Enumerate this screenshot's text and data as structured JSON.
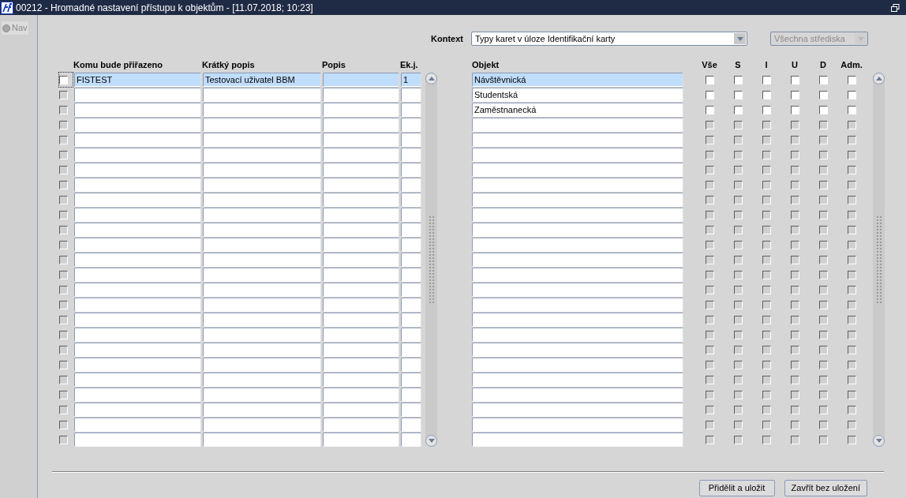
{
  "window": {
    "title": "00212 - Hromadné nastavení přístupu k objektům - [11.07.2018; 10:23]"
  },
  "sidebar": {
    "items": [
      {
        "label": "Nav",
        "selected": false
      }
    ]
  },
  "kontext": {
    "label": "Kontext",
    "value": "Typy karet v úloze Identifikační karty",
    "disabled": false
  },
  "strediska": {
    "value": "Všechna střediska",
    "disabled": true
  },
  "left_table": {
    "columns": [
      "Komu bude přiřazeno",
      "Krátký popis",
      "Popis",
      "Ek.j."
    ],
    "rows": [
      {
        "selected": true,
        "disabled": false,
        "checked": false,
        "cells": [
          "FISTEST",
          "Testovací uživatel BBM",
          "",
          "1"
        ]
      },
      {
        "selected": false,
        "disabled": true,
        "checked": false,
        "cells": []
      },
      {
        "selected": false,
        "disabled": true,
        "checked": false,
        "cells": []
      },
      {
        "selected": false,
        "disabled": true,
        "checked": false,
        "cells": []
      },
      {
        "selected": false,
        "disabled": true,
        "checked": false,
        "cells": []
      },
      {
        "selected": false,
        "disabled": true,
        "checked": false,
        "cells": []
      },
      {
        "selected": false,
        "disabled": true,
        "checked": false,
        "cells": []
      },
      {
        "selected": false,
        "disabled": true,
        "checked": false,
        "cells": []
      },
      {
        "selected": false,
        "disabled": true,
        "checked": false,
        "cells": []
      },
      {
        "selected": false,
        "disabled": true,
        "checked": false,
        "cells": []
      },
      {
        "selected": false,
        "disabled": true,
        "checked": false,
        "cells": []
      },
      {
        "selected": false,
        "disabled": true,
        "checked": false,
        "cells": []
      },
      {
        "selected": false,
        "disabled": true,
        "checked": false,
        "cells": []
      },
      {
        "selected": false,
        "disabled": true,
        "checked": false,
        "cells": []
      },
      {
        "selected": false,
        "disabled": true,
        "checked": false,
        "cells": []
      },
      {
        "selected": false,
        "disabled": true,
        "checked": false,
        "cells": []
      },
      {
        "selected": false,
        "disabled": true,
        "checked": false,
        "cells": []
      },
      {
        "selected": false,
        "disabled": true,
        "checked": false,
        "cells": []
      },
      {
        "selected": false,
        "disabled": true,
        "checked": false,
        "cells": []
      },
      {
        "selected": false,
        "disabled": true,
        "checked": false,
        "cells": []
      },
      {
        "selected": false,
        "disabled": true,
        "checked": false,
        "cells": []
      },
      {
        "selected": false,
        "disabled": true,
        "checked": false,
        "cells": []
      },
      {
        "selected": false,
        "disabled": true,
        "checked": false,
        "cells": []
      },
      {
        "selected": false,
        "disabled": true,
        "checked": false,
        "cells": []
      },
      {
        "selected": false,
        "disabled": true,
        "checked": false,
        "cells": []
      }
    ]
  },
  "right_table": {
    "columns": [
      "Objekt",
      "Vše",
      "S",
      "I",
      "U",
      "D",
      "Adm."
    ],
    "rows": [
      {
        "objekt": "Návštěvnická",
        "selected": true,
        "disabled": false,
        "checked": [
          false,
          false,
          false,
          false,
          false,
          false
        ]
      },
      {
        "objekt": "Studentská",
        "selected": false,
        "disabled": false,
        "checked": [
          false,
          false,
          false,
          false,
          false,
          false
        ]
      },
      {
        "objekt": "Zaměstnanecká",
        "selected": false,
        "disabled": false,
        "checked": [
          false,
          false,
          false,
          false,
          false,
          false
        ]
      },
      {
        "selected": false,
        "disabled": true,
        "checked": [
          false,
          false,
          false,
          false,
          false,
          false
        ]
      },
      {
        "selected": false,
        "disabled": true,
        "checked": [
          false,
          false,
          false,
          false,
          false,
          false
        ]
      },
      {
        "selected": false,
        "disabled": true,
        "checked": [
          false,
          false,
          false,
          false,
          false,
          false
        ]
      },
      {
        "selected": false,
        "disabled": true,
        "checked": [
          false,
          false,
          false,
          false,
          false,
          false
        ]
      },
      {
        "selected": false,
        "disabled": true,
        "checked": [
          false,
          false,
          false,
          false,
          false,
          false
        ]
      },
      {
        "selected": false,
        "disabled": true,
        "checked": [
          false,
          false,
          false,
          false,
          false,
          false
        ]
      },
      {
        "selected": false,
        "disabled": true,
        "checked": [
          false,
          false,
          false,
          false,
          false,
          false
        ]
      },
      {
        "selected": false,
        "disabled": true,
        "checked": [
          false,
          false,
          false,
          false,
          false,
          false
        ]
      },
      {
        "selected": false,
        "disabled": true,
        "checked": [
          false,
          false,
          false,
          false,
          false,
          false
        ]
      },
      {
        "selected": false,
        "disabled": true,
        "checked": [
          false,
          false,
          false,
          false,
          false,
          false
        ]
      },
      {
        "selected": false,
        "disabled": true,
        "checked": [
          false,
          false,
          false,
          false,
          false,
          false
        ]
      },
      {
        "selected": false,
        "disabled": true,
        "checked": [
          false,
          false,
          false,
          false,
          false,
          false
        ]
      },
      {
        "selected": false,
        "disabled": true,
        "checked": [
          false,
          false,
          false,
          false,
          false,
          false
        ]
      },
      {
        "selected": false,
        "disabled": true,
        "checked": [
          false,
          false,
          false,
          false,
          false,
          false
        ]
      },
      {
        "selected": false,
        "disabled": true,
        "checked": [
          false,
          false,
          false,
          false,
          false,
          false
        ]
      },
      {
        "selected": false,
        "disabled": true,
        "checked": [
          false,
          false,
          false,
          false,
          false,
          false
        ]
      },
      {
        "selected": false,
        "disabled": true,
        "checked": [
          false,
          false,
          false,
          false,
          false,
          false
        ]
      },
      {
        "selected": false,
        "disabled": true,
        "checked": [
          false,
          false,
          false,
          false,
          false,
          false
        ]
      },
      {
        "selected": false,
        "disabled": true,
        "checked": [
          false,
          false,
          false,
          false,
          false,
          false
        ]
      },
      {
        "selected": false,
        "disabled": true,
        "checked": [
          false,
          false,
          false,
          false,
          false,
          false
        ]
      },
      {
        "selected": false,
        "disabled": true,
        "checked": [
          false,
          false,
          false,
          false,
          false,
          false
        ]
      },
      {
        "selected": false,
        "disabled": true,
        "checked": [
          false,
          false,
          false,
          false,
          false,
          false
        ]
      }
    ]
  },
  "buttons": [
    "Přidělit a uložit",
    "Zavřít bez uložení"
  ]
}
